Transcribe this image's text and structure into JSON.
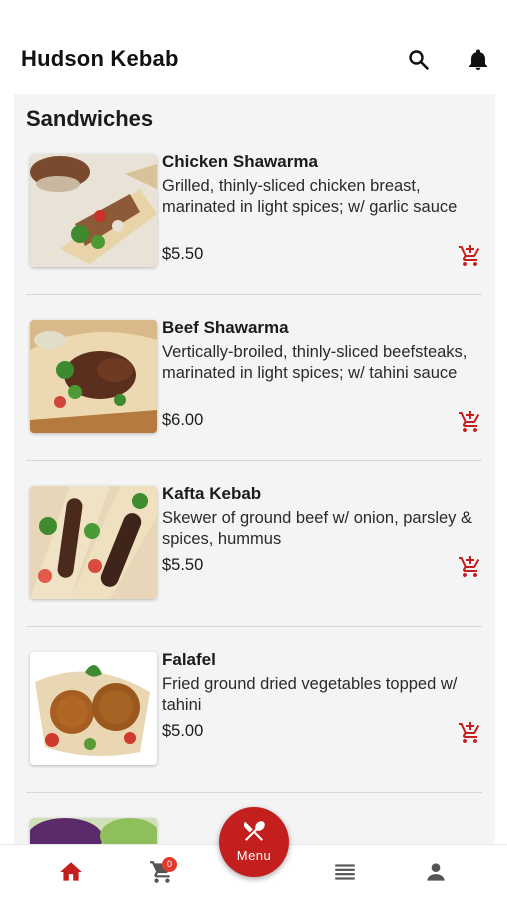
{
  "app": {
    "title": "Hudson Kebab"
  },
  "colors": {
    "accent": "#c41f1f",
    "badge": "#e23a2f",
    "content_bg": "#f4f4f4"
  },
  "header_icons": [
    "search-icon",
    "bell-icon"
  ],
  "section": {
    "title": "Sandwiches"
  },
  "items": [
    {
      "name": "Chicken Shawarma",
      "description": "Grilled, thinly-sliced chicken breast, marinated in light spices; w/ garlic sauce",
      "price": "$5.50"
    },
    {
      "name": "Beef Shawarma",
      "description": "Vertically-broiled, thinly-sliced beefsteaks, marinated in light spices; w/ tahini sauce",
      "price": "$6.00"
    },
    {
      "name": "Kafta Kebab",
      "description": "Skewer of ground beef w/ onion, parsley & spices, hummus",
      "price": "$5.50"
    },
    {
      "name": "Falafel",
      "description": "Fried ground dried vegetables topped w/ tahini",
      "price": "$5.00"
    }
  ],
  "nav": {
    "cart_count": "0",
    "menu_label": "Menu",
    "icons": [
      "home-icon",
      "cart-icon",
      "menu-fab-icon",
      "list-icon",
      "profile-icon"
    ]
  }
}
